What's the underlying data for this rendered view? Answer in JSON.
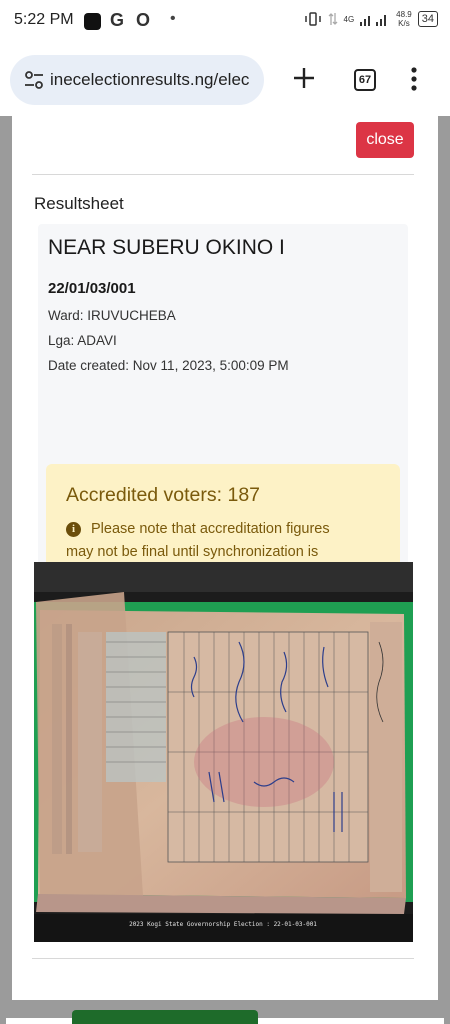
{
  "status_bar": {
    "time": "5:22 PM",
    "icon_g": "G",
    "icon_o": "O",
    "dot": "•",
    "net_type": "4G",
    "net_speed": "48.9\nK/s",
    "battery": "34"
  },
  "browser": {
    "url": "inecelectionresults.ng/elec",
    "tab_count": "67"
  },
  "modal": {
    "close_label": "close",
    "section_title": "Resultsheet",
    "polling_unit": {
      "name": "NEAR SUBERU OKINO I",
      "code": "22/01/03/001",
      "ward": "Ward: IRUVUCHEBA",
      "lga": "Lga: ADAVI",
      "date_created": "Date created: Nov 11, 2023, 5:00:09 PM"
    },
    "accreditation": {
      "title": "Accredited voters: 187",
      "note": "Please note that accreditation figures may not be final until synchronization is completed from the devices used in this location"
    },
    "result_sheet_image": {
      "footer_caption": "2023 Kogi State Governorship Election : 22-01-03-001",
      "table_header_name": "NAME / SIGNATURE OF POLLING AGENT",
      "table_header_votes": "VOTES SCORED",
      "parties": [
        "A",
        "AA",
        "AAC",
        "ADC",
        "ADP",
        "APGA",
        "APM",
        "APP",
        "BP",
        "LP",
        "NNPP",
        "NRM",
        "PDP",
        "SDP",
        "YPP",
        "ZLP"
      ],
      "figures": [
        "493",
        "410",
        "430",
        "000",
        "000",
        "101",
        "187",
        "187",
        "180"
      ]
    }
  },
  "colors": {
    "close_button": "#dc3545",
    "alert_bg": "#fdf2c6",
    "alert_text": "#7a5a0c",
    "url_pill": "#e8eef7"
  }
}
